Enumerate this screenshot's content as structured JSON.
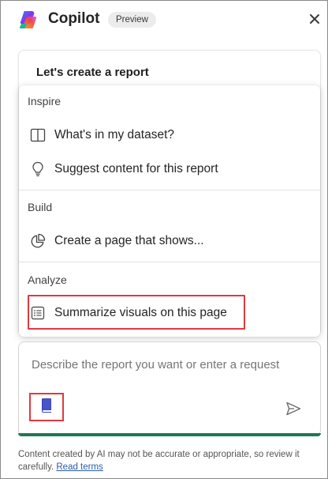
{
  "header": {
    "app_name": "Copilot",
    "badge": "Preview",
    "logo_icon": "copilot-logo-icon",
    "close_icon": "close-icon"
  },
  "card": {
    "title": "Let's create a report"
  },
  "menu": {
    "sections": [
      {
        "label": "Inspire",
        "items": [
          {
            "label": "What's in my dataset?",
            "icon": "book-open-icon"
          },
          {
            "label": "Suggest content for this report",
            "icon": "lightbulb-icon"
          }
        ]
      },
      {
        "label": "Build",
        "items": [
          {
            "label": "Create a page that shows...",
            "icon": "pie-chart-icon"
          }
        ]
      },
      {
        "label": "Analyze",
        "items": [
          {
            "label": "Summarize visuals on this page",
            "icon": "list-document-icon"
          }
        ]
      }
    ]
  },
  "input": {
    "placeholder": "Describe the report you want or enter a request",
    "prompt_guide_icon": "book-icon",
    "send_icon": "send-icon"
  },
  "footer": {
    "disclaimer": "Content created by AI may not be accurate or appropriate, so review it carefully.",
    "link": "Read terms"
  },
  "colors": {
    "highlight": "#e0393e",
    "accent_bar": "#1d7a53",
    "link": "#2a5da8"
  }
}
